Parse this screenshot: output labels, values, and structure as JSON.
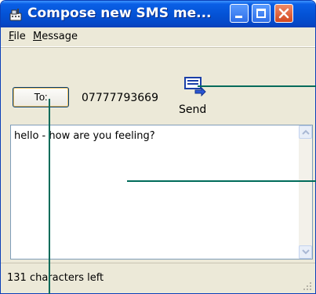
{
  "window": {
    "title": "Compose new SMS me..."
  },
  "menu": {
    "file_rest": "ile",
    "file_mnemonic": "F",
    "message_rest": "essage",
    "message_mnemonic": "M"
  },
  "compose": {
    "to_button_label": "To:",
    "phone_number": "07777793669",
    "send_label": "Send",
    "message_text": "hello - how are you feeling?"
  },
  "status": {
    "text": "131 characters left"
  },
  "colors": {
    "titlebar": "#0453d6",
    "callout_line": "#006b5a",
    "close_button": "#d2471f"
  },
  "icons": {
    "app": "phone-icon",
    "send": "send-message-icon"
  }
}
